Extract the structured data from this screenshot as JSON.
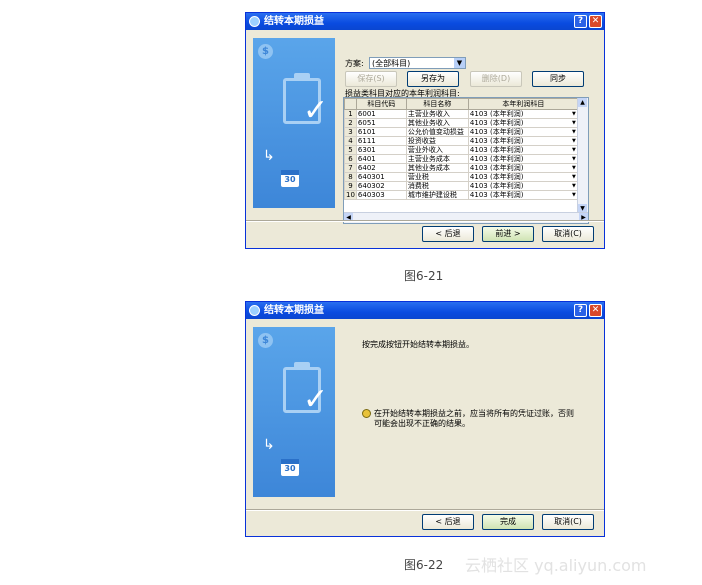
{
  "dialog1": {
    "title": "结转本期损益",
    "scheme_label": "方案:",
    "scheme_value": "(全部科目)",
    "buttons": {
      "save": "保存(S)",
      "save_as": "另存为",
      "delete": "删除(D)",
      "sync": "同步"
    },
    "grid_label": "损益类科目对应的本年利润科目:",
    "columns": [
      "",
      "科目代码",
      "科目名称",
      "本年利润科目"
    ],
    "rows": [
      [
        "1",
        "6001",
        "主营业务收入",
        "4103 (本年利润)"
      ],
      [
        "2",
        "6051",
        "其他业务收入",
        "4103 (本年利润)"
      ],
      [
        "3",
        "6101",
        "公允价值变动损益",
        "4103 (本年利润)"
      ],
      [
        "4",
        "6111",
        "投资收益",
        "4103 (本年利润)"
      ],
      [
        "5",
        "6301",
        "营业外收入",
        "4103 (本年利润)"
      ],
      [
        "6",
        "6401",
        "主营业务成本",
        "4103 (本年利润)"
      ],
      [
        "7",
        "6402",
        "其他业务成本",
        "4103 (本年利润)"
      ],
      [
        "8",
        "640301",
        "营业税",
        "4103 (本年利润)"
      ],
      [
        "9",
        "640302",
        "消费税",
        "4103 (本年利润)"
      ],
      [
        "10",
        "640303",
        "城市维护建设税",
        "4103 (本年利润)"
      ]
    ],
    "nav": {
      "back": "< 后退",
      "next": "前进 >",
      "cancel": "取消(C)"
    }
  },
  "caption1": "图6-21",
  "dialog2": {
    "title": "结转本期损益",
    "message": "按完成按钮开始结转本期损益。",
    "warning": "在开始结转本期损益之前，应当将所有的凭证过账，否则可能会出现不正确的结果。",
    "nav": {
      "back": "< 后退",
      "finish": "完成",
      "cancel": "取消(C)"
    }
  },
  "caption2": "图6-22",
  "watermark": "云栖社区 yq.aliyun.com",
  "icons": {
    "help": "?",
    "close": "✕",
    "calendar_day": "30",
    "coin": "$"
  }
}
